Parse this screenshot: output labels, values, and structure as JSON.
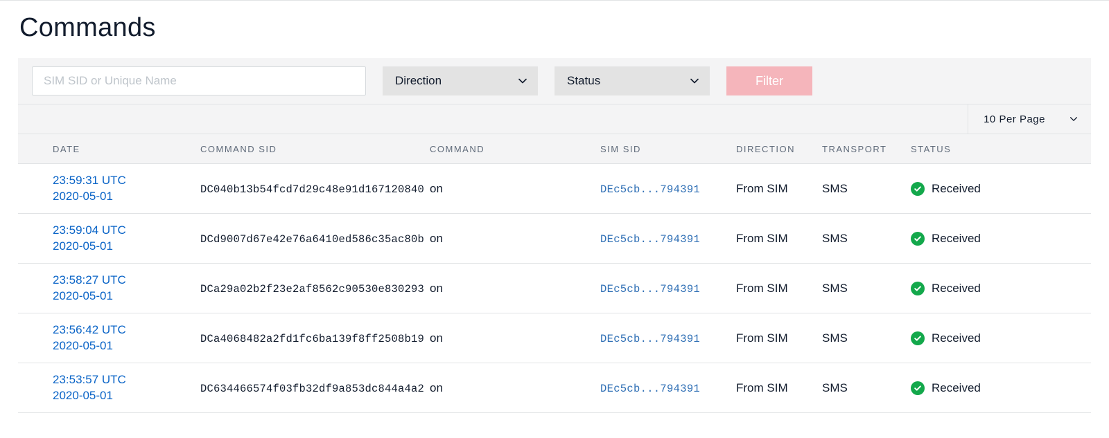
{
  "page": {
    "title": "Commands"
  },
  "filters": {
    "search_placeholder": "SIM SID or Unique Name",
    "direction_label": "Direction",
    "status_label": "Status",
    "filter_button": "Filter"
  },
  "pagination": {
    "per_page_label": "10 Per Page"
  },
  "columns": {
    "date": "DATE",
    "command_sid": "COMMAND SID",
    "command": "COMMAND",
    "sim_sid": "SIM SID",
    "direction": "DIRECTION",
    "transport": "TRANSPORT",
    "status": "STATUS"
  },
  "rows": [
    {
      "time": "23:59:31 UTC",
      "date": "2020-05-01",
      "command_sid": "DC040b13b54fcd7d29c48e91d167120840",
      "command": "on",
      "sim_sid": "DEc5cb...794391",
      "direction": "From SIM",
      "transport": "SMS",
      "status": "Received"
    },
    {
      "time": "23:59:04 UTC",
      "date": "2020-05-01",
      "command_sid": "DCd9007d67e42e76a6410ed586c35ac80b",
      "command": "on",
      "sim_sid": "DEc5cb...794391",
      "direction": "From SIM",
      "transport": "SMS",
      "status": "Received"
    },
    {
      "time": "23:58:27 UTC",
      "date": "2020-05-01",
      "command_sid": "DCa29a02b2f23e2af8562c90530e830293",
      "command": "on",
      "sim_sid": "DEc5cb...794391",
      "direction": "From SIM",
      "transport": "SMS",
      "status": "Received"
    },
    {
      "time": "23:56:42 UTC",
      "date": "2020-05-01",
      "command_sid": "DCa4068482a2fd1fc6ba139f8ff2508b19",
      "command": "on",
      "sim_sid": "DEc5cb...794391",
      "direction": "From SIM",
      "transport": "SMS",
      "status": "Received"
    },
    {
      "time": "23:53:57 UTC",
      "date": "2020-05-01",
      "command_sid": "DC634466574f03fb32df9a853dc844a4a2",
      "command": "on",
      "sim_sid": "DEc5cb...794391",
      "direction": "From SIM",
      "transport": "SMS",
      "status": "Received"
    }
  ]
}
